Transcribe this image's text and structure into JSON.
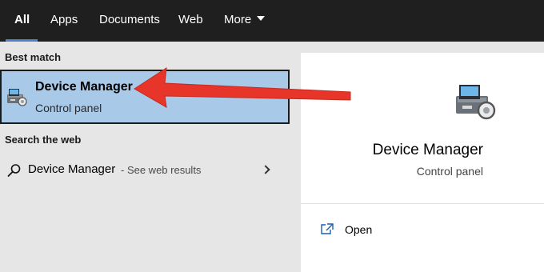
{
  "tabs": [
    {
      "label": "All",
      "active": true
    },
    {
      "label": "Apps"
    },
    {
      "label": "Documents"
    },
    {
      "label": "Web"
    },
    {
      "label": "More"
    }
  ],
  "left": {
    "best_match_header": "Best match",
    "best_match": {
      "title": "Device Manager",
      "subtitle": "Control panel",
      "icon": "device-manager-icon"
    },
    "search_web_header": "Search the web",
    "web_result": {
      "query": "Device Manager",
      "suffix": " - See web results",
      "icon": "search-icon"
    }
  },
  "right": {
    "title": "Device Manager",
    "subtitle": "Control panel",
    "icon": "device-manager-icon",
    "actions": [
      {
        "label": "Open",
        "icon": "open-icon"
      }
    ]
  },
  "colors": {
    "topbar": "#1f1f1f",
    "accent_underline": "#4f7fc7",
    "selected_bg": "#a9c9e8",
    "annotation_arrow": "#e8352a"
  }
}
